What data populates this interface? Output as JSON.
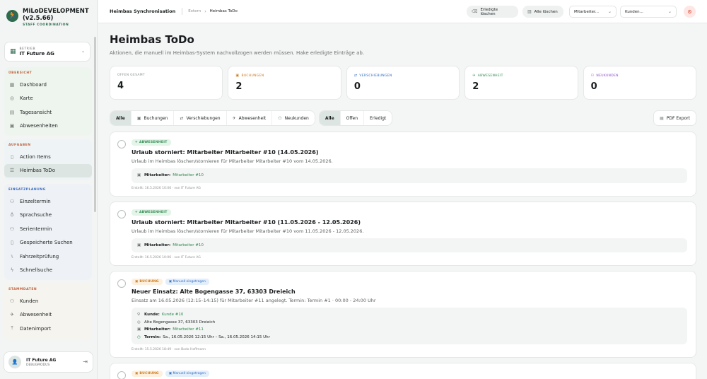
{
  "brand": {
    "title_line1": "MiLoDEVELOPMENT",
    "title_line2": "(v2.5.66)",
    "subtitle": "STAFF COORDINATION"
  },
  "betrieb": {
    "label": "BETRIEB",
    "value": "IT Future AG"
  },
  "nav": {
    "uebersicht": {
      "head": "ÜBERSICHT",
      "items": [
        "Dashboard",
        "Karte",
        "Tagesansicht",
        "Abwesenheiten"
      ]
    },
    "aufgaben": {
      "head": "AUFGABEN",
      "items": [
        "Action Items",
        "Heimbas ToDo"
      ]
    },
    "einsatzplanung": {
      "head": "EINSATZPLANUNG",
      "items": [
        "Einzeltermin",
        "Sprachsuche",
        "Serientermin",
        "Gespeicherte Suchen",
        "Fahrzeitprüfung",
        "Schnellsuche"
      ]
    },
    "stammdaten": {
      "head": "STAMMDATEN",
      "items": [
        "Kunden",
        "Abwesenheit",
        "Datenimport"
      ]
    }
  },
  "user": {
    "name": "IT Future AG",
    "sub": "DEBUGMODUS"
  },
  "topbar": {
    "title": "Heimbas Synchronisation",
    "crumb_parent": "Extern",
    "crumb_current": "Heimbas ToDo",
    "btn_erledigte": "Erledigte löschen",
    "btn_alle": "Alle löschen",
    "select_mitarbeiter": "Mitarbeiter...",
    "select_kunden": "Kunden..."
  },
  "page": {
    "title": "Heimbas ToDo",
    "subtitle": "Aktionen, die manuell im Heimbas-System nachvollzogen werden müssen. Hake erledigte Einträge ab."
  },
  "stats": [
    {
      "label": "OFFEN GESAMT",
      "value": "4",
      "color": "#8c9390"
    },
    {
      "label": "BUCHUNGEN",
      "value": "2",
      "color": "#c97818"
    },
    {
      "label": "VERSCHIEBUNGEN",
      "value": "0",
      "color": "#2d6cc0"
    },
    {
      "label": "ABWESENHEIT",
      "value": "2",
      "color": "#2f8a4f"
    },
    {
      "label": "NEUKUNDEN",
      "value": "0",
      "color": "#8a4fc9"
    }
  ],
  "filters": {
    "types": [
      "Alle",
      "Buchungen",
      "Verschiebungen",
      "Abwesenheit",
      "Neukunden"
    ],
    "status": [
      "Alle",
      "Offen",
      "Erledigt"
    ],
    "pdf": "PDF Export"
  },
  "cards": [
    {
      "tag": "ABWESENHEIT",
      "title": "Urlaub storniert: Mitarbeiter Mitarbeiter #10 (14.05.2026)",
      "desc": "Urlaub im Heimbas löschen/stornieren für Mitarbeiter Mitarbeiter #10 vom 14.05.2026.",
      "row_label": "Mitarbeiter:",
      "row_value": "Mitarbeiter #10",
      "meta": "Erstellt: 16.5.2026 10:06 · von IT Future AG"
    },
    {
      "tag": "ABWESENHEIT",
      "title": "Urlaub storniert: Mitarbeiter Mitarbeiter #10 (11.05.2026 - 12.05.2026)",
      "desc": "Urlaub im Heimbas löschen/stornieren für Mitarbeiter Mitarbeiter #10 vom 11.05.2026 - 12.05.2026.",
      "row_label": "Mitarbeiter:",
      "row_value": "Mitarbeiter #10",
      "meta": "Erstellt: 16.5.2026 10:06 · von IT Future AG"
    },
    {
      "tag": "BUCHUNG",
      "tag2": "Manuell eingetragen",
      "title": "Neuer Einsatz: Alte Bogengasse 37, 63303 Dreieich",
      "desc": "Einsatz am 16.05.2026 (12:15–14:15) für Mitarbeiter #11 angelegt. Termin: Termin #1 · 00:00 - 24:00 Uhr",
      "kunde_label": "Kunde:",
      "kunde_value": "Kunde #10",
      "address": "Alte Bogengasse 37, 63303 Dreieich",
      "ma_label": "Mitarbeiter:",
      "ma_value": "Mitarbeiter #11",
      "termin_label": "Termin:",
      "termin_value": "Sa., 16.05.2026 12:15 Uhr – Sa., 16.05.2026 14:15 Uhr",
      "meta": "Erstellt: 15.5.2026 18:49 · von Bodo Hoffmann"
    },
    {
      "tag": "BUCHUNG",
      "tag2": "Manuell eingetragen"
    }
  ]
}
